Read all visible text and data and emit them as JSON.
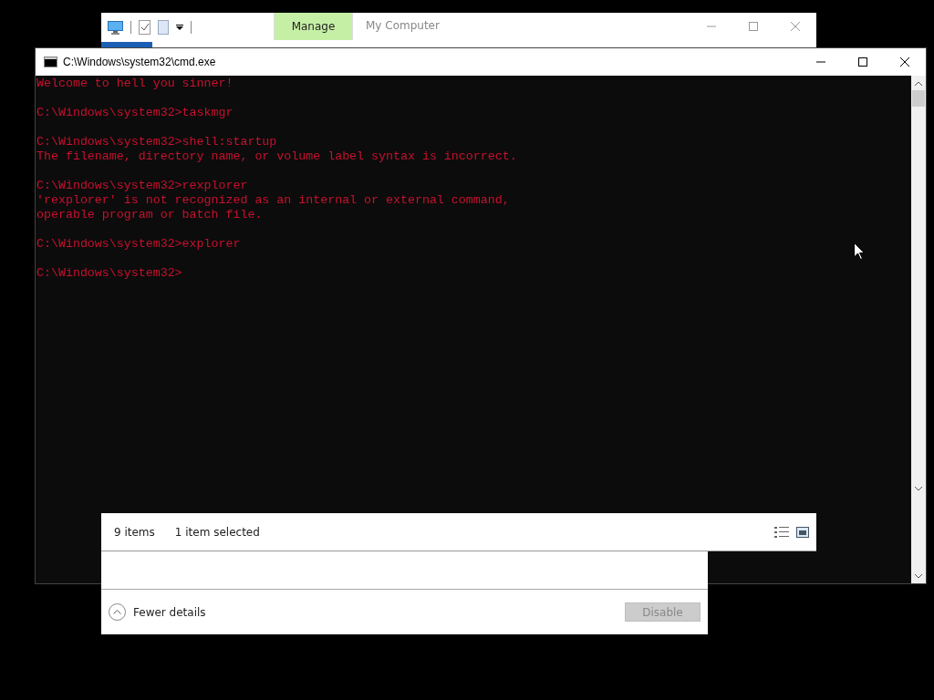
{
  "explorer_window": {
    "title": "My Computer",
    "ribbon_tab": {
      "label": "Manage",
      "selected": true
    },
    "status_bar": {
      "item_count": "9 items",
      "selection": "1 item selected"
    }
  },
  "cmd_window": {
    "title": "C:\\Windows\\system32\\cmd.exe",
    "blocks": [
      [
        "Welcome to hell you sinner!"
      ],
      [
        "C:\\Windows\\system32>taskmgr"
      ],
      [
        "C:\\Windows\\system32>shell:startup",
        "The filename, directory name, or volume label syntax is incorrect."
      ],
      [
        "C:\\Windows\\system32>rexplorer",
        "'rexplorer' is not recognized as an internal or external command,",
        "operable program or batch file."
      ],
      [
        "C:\\Windows\\system32>explorer"
      ],
      [
        "C:\\Windows\\system32>"
      ]
    ]
  },
  "task_manager_window": {
    "details_toggle": "Fewer details",
    "action_button": {
      "label": "Disable",
      "disabled": true
    }
  }
}
